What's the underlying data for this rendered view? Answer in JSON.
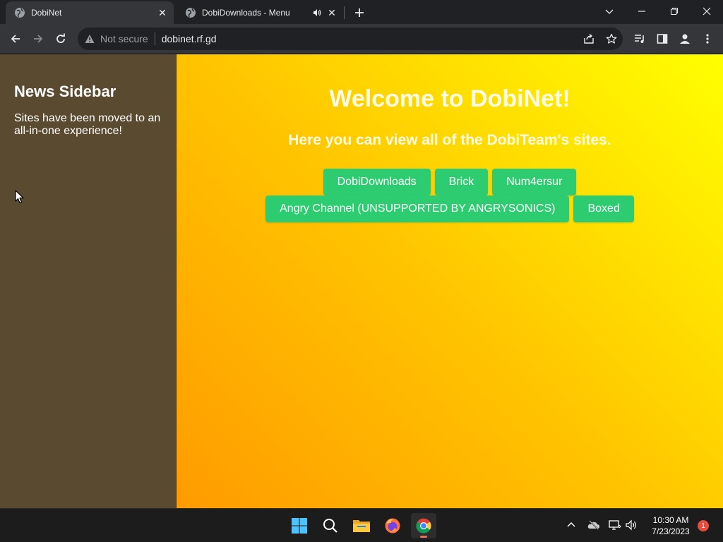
{
  "browser": {
    "tabs": [
      {
        "title": "DobiNet",
        "active": true,
        "icon": "globe-icon"
      },
      {
        "title": "DobiDownloads - Menu",
        "active": false,
        "icon": "globe-icon",
        "audio": true
      }
    ],
    "address": {
      "security_label": "Not secure",
      "url": "dobinet.rf.gd"
    }
  },
  "page": {
    "sidebar": {
      "title": "News Sidebar",
      "text": "Sites have been moved to an all-in-one experience!"
    },
    "heading": "Welcome to DobiNet!",
    "subheading": "Here you can view all of the DobiTeam's sites.",
    "buttons_row1": [
      "DobiDownloads",
      "Brick",
      "Num4ersur"
    ],
    "buttons_row2": [
      "Angry Channel (UNSUPPORTED BY ANGRYSONICS)",
      "Boxed"
    ]
  },
  "taskbar": {
    "time": "10:30 AM",
    "date": "7/23/2023",
    "notifications": "1"
  },
  "colors": {
    "button": "#2ecc71",
    "sidebar": "#5a4a30",
    "gradient_start": "#ff8c00",
    "gradient_end": "#ffff00"
  }
}
